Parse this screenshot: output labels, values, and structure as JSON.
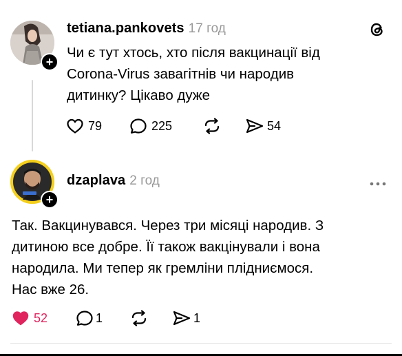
{
  "colors": {
    "like_active": "#e0245e",
    "muted": "#999999",
    "text": "#000000"
  },
  "posts": [
    {
      "username": "tetiana.pankovets",
      "time": "17 год",
      "text_lines": [
        "Чи є тут хтось, хто після вакцинації від",
        "Corona-Virus завагітнів чи народив",
        "дитинку? Цікаво дуже"
      ],
      "likes": "79",
      "comments": "225",
      "shares": "54",
      "liked": false
    },
    {
      "username": "dzaplava",
      "time": "2 год",
      "text_lines": [
        "Так. Вакцинувався. Через три місяці народив. З",
        "дитиною все добре. Її також вакцінували і вона",
        "народила. Ми тепер як гремліни плідниємося.",
        "Нас вже 26."
      ],
      "likes": "52",
      "comments": "1",
      "shares": "1",
      "liked": true
    }
  ],
  "icons": {
    "threads_logo": "threads-logo-icon",
    "more": "more-options-icon",
    "follow": "plus-icon",
    "like": "heart-icon",
    "comment": "comment-icon",
    "repost": "repost-icon",
    "share": "share-icon"
  }
}
